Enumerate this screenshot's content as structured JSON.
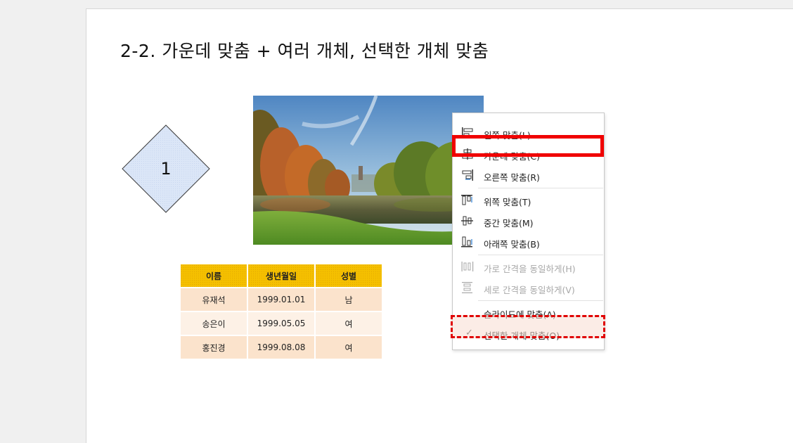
{
  "slide": {
    "title": "2-2. 가운데 맞춤 + 여러 개체, 선택한 개체 맞춤"
  },
  "diamond": {
    "label": "1",
    "fill": "#dbe6f7",
    "stroke": "#3a3a3a"
  },
  "table": {
    "headers": [
      "이름",
      "생년월일",
      "성별"
    ],
    "rows": [
      [
        "유재석",
        "1999.01.01",
        "남"
      ],
      [
        "송은이",
        "1999.05.05",
        "여"
      ],
      [
        "홍진경",
        "1999.08.08",
        "여"
      ]
    ],
    "header_color": "#f5c000",
    "row_colors": [
      "#fbe3cc",
      "#fdf1e6"
    ]
  },
  "menu": {
    "items": [
      {
        "label": "왼쪽 맞춤(L)",
        "icon": "align-left-icon",
        "enabled": true
      },
      {
        "label": "가운데 맞춤(C)",
        "icon": "align-center-icon",
        "enabled": true
      },
      {
        "label": "오른쪽 맞춤(R)",
        "icon": "align-right-icon",
        "enabled": true
      },
      {
        "label": "위쪽 맞춤(T)",
        "icon": "align-top-icon",
        "enabled": true
      },
      {
        "label": "중간 맞춤(M)",
        "icon": "align-middle-icon",
        "enabled": true
      },
      {
        "label": "아래쪽 맞춤(B)",
        "icon": "align-bottom-icon",
        "enabled": true
      },
      {
        "label": "가로 간격을 동일하게(H)",
        "icon": "distribute-horizontal-icon",
        "enabled": false
      },
      {
        "label": "세로 간격을 동일하게(V)",
        "icon": "distribute-vertical-icon",
        "enabled": false
      },
      {
        "label": "슬라이드에 맞춤(A)",
        "icon": "",
        "enabled": true
      },
      {
        "label": "선택한 개체 맞춤(O)",
        "icon": "checkmark-icon",
        "enabled": true,
        "checked": true
      }
    ],
    "checkmark": "✓",
    "highlight_color": "#f00000"
  }
}
